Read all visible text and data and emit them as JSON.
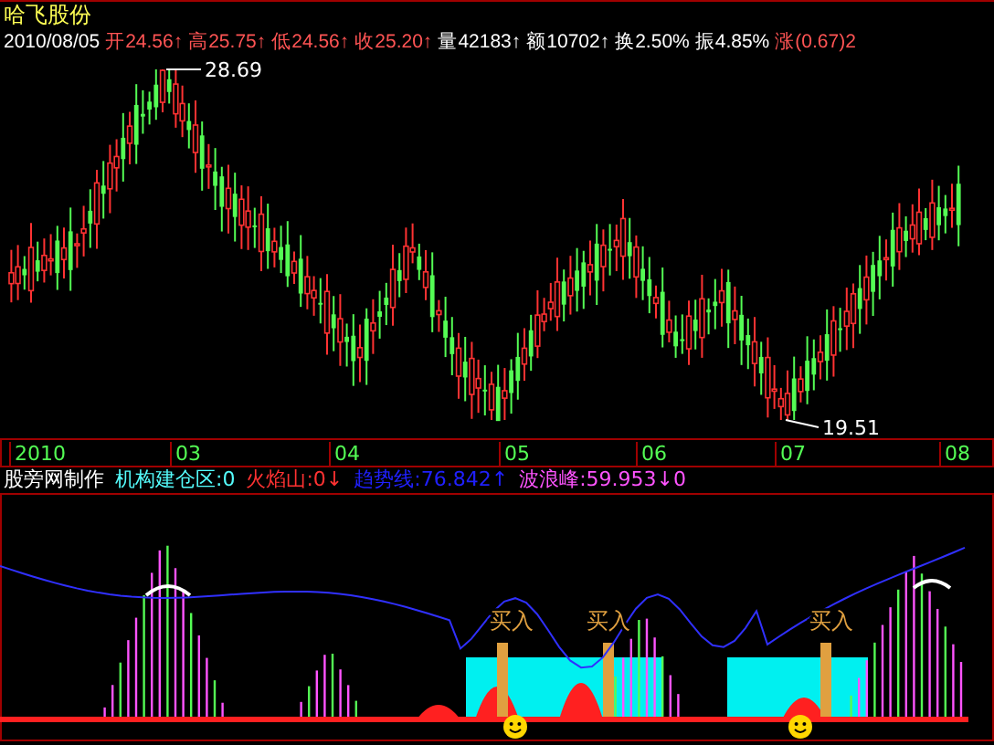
{
  "stock_name": "哈飞股份",
  "quote": {
    "date": "2010/08/05",
    "items": [
      {
        "text": "开24.56↑",
        "kind": "up"
      },
      {
        "text": "高25.75↑",
        "kind": "up"
      },
      {
        "text": "低24.56↑",
        "kind": "up"
      },
      {
        "text": "收25.20↑",
        "kind": "up"
      },
      {
        "text": "量42183↑",
        "kind": "plain"
      },
      {
        "text": "额10702↑",
        "kind": "plain"
      },
      {
        "text": "换2.50%",
        "kind": "plain"
      },
      {
        "text": "振4.85%",
        "kind": "plain"
      },
      {
        "text": "涨(0.67)2",
        "kind": "up"
      }
    ]
  },
  "price_chart": {
    "high_label": "28.69",
    "low_label": "19.51"
  },
  "x_axis": [
    "2010",
    "03",
    "04",
    "05",
    "06",
    "07",
    "08"
  ],
  "indicator": {
    "legend": [
      {
        "text": "股旁网制作",
        "color": "#ffffff"
      },
      {
        "text": "机构建仓区:0",
        "color": "#54fcfc"
      },
      {
        "text": "火焰山:0↓",
        "color": "#ff3232"
      },
      {
        "text": "趋势线:76.842↑",
        "color": "#2020ff"
      },
      {
        "text": "波浪峰:59.953↓0",
        "color": "#ff54ff"
      }
    ],
    "signals": [
      "买入",
      "买入",
      "买入"
    ]
  }
}
